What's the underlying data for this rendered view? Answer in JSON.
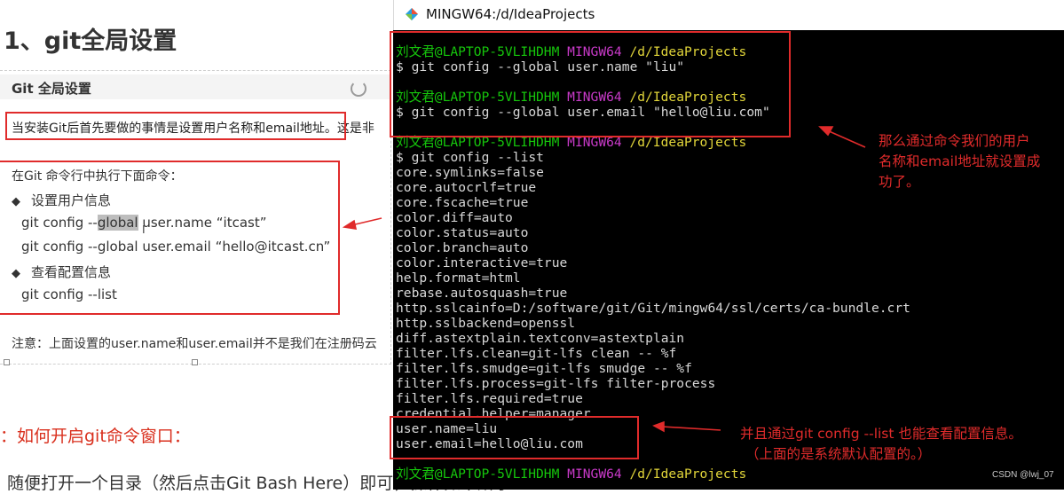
{
  "doc": {
    "heading": "1、git全局设置",
    "slide_title": "Git 全局设置",
    "intro": "当安装Git后首先要做的事情是设置用户名称和email地址。这是非",
    "cmd_intro": "在Git 命令行中执行下面命令：",
    "section_user": "设置用户信息",
    "cmd1_pre": "git config --",
    "cmd1_hl": "global",
    "cmd1_post": " user.name  “itcast”",
    "cmd2": "git config --global user.email  “hello@itcast.cn”",
    "section_view": "查看配置信息",
    "cmd3": "git config --list",
    "note": "注意：上面设置的user.name和user.email并不是我们在注册码云",
    "howto": "：如何开启git命令窗口：",
    "step": "随便打开一个目录（然后点击Git Bash Here）即可，操作如下所示："
  },
  "terminal": {
    "title": "MINGW64:/d/IdeaProjects",
    "prompt_user": "刘文君@LAPTOP-5VLIHDHM",
    "prompt_sys": "MINGW64",
    "prompt_path": "/d/IdeaProjects",
    "cmd_name": "$ git config --global user.name \"liu\"",
    "cmd_email": "$ git config --global user.email \"hello@liu.com\"",
    "cmd_list": "$ git config --list",
    "output": [
      "core.symlinks=false",
      "core.autocrlf=true",
      "core.fscache=true",
      "color.diff=auto",
      "color.status=auto",
      "color.branch=auto",
      "color.interactive=true",
      "help.format=html",
      "rebase.autosquash=true",
      "http.sslcainfo=D:/software/git/Git/mingw64/ssl/certs/ca-bundle.crt",
      "http.sslbackend=openssl",
      "diff.astextplain.textconv=astextplain",
      "filter.lfs.clean=git-lfs clean -- %f",
      "filter.lfs.smudge=git-lfs smudge -- %f",
      "filter.lfs.process=git-lfs filter-process",
      "filter.lfs.required=true",
      "credential.helper=manager",
      "user.name=liu",
      "user.email=hello@liu.com"
    ]
  },
  "annotations": {
    "right_top": [
      "那么通过命令我们的用户",
      "名称和email地址就设置成",
      "功了。"
    ],
    "right_bottom": [
      "并且通过git config --list 也能查看配置信息。",
      "（上面的是系统默认配置的。）"
    ]
  },
  "watermark": "CSDN @lwj_07",
  "colors": {
    "annotation_red": "#e02b2b",
    "prompt_green": "#16c60c",
    "prompt_magenta": "#c93ac9",
    "prompt_yellow": "#e2d63a"
  }
}
